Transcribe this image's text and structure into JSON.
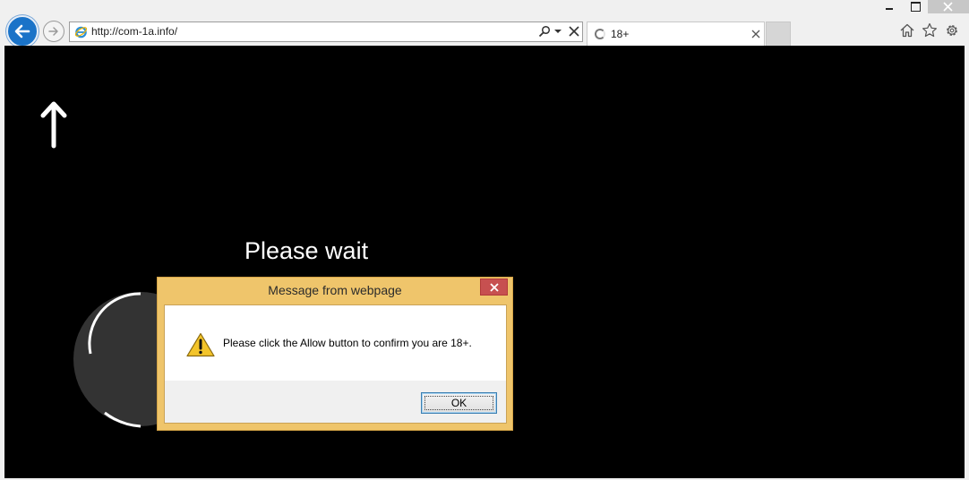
{
  "browser": {
    "url": "http://com-1a.info/",
    "tab_title": "18+",
    "icons": {
      "back": "back-arrow-icon",
      "forward": "forward-arrow-icon",
      "site": "ie-icon",
      "search": "search-icon",
      "stop": "close-icon",
      "home": "home-icon",
      "favorites": "star-icon",
      "tools": "gear-icon"
    }
  },
  "page": {
    "heading": "Please wait",
    "background": "#000000"
  },
  "dialog": {
    "title": "Message from webpage",
    "message": "Please click the Allow button to confirm you are 18+.",
    "ok_label": "OK",
    "frame_color": "#efc56b",
    "close_color": "#c75050"
  }
}
